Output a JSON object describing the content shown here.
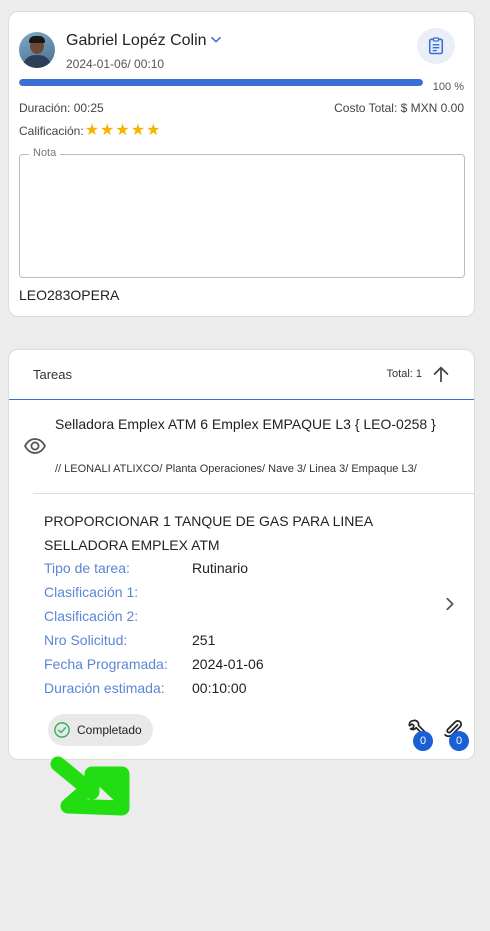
{
  "header": {
    "user_name": "Gabriel Lopéz Colin",
    "date_time": "2024-01-06/ 00:10",
    "progress_percent": 100,
    "progress_label": "100 %",
    "duration_label": "Duración:",
    "duration_value": "00:25",
    "cost_label": "Costo Total:",
    "cost_value": "$ MXN 0.00",
    "rating_label": "Calificación:",
    "rating_stars": 5,
    "note_label": "Nota",
    "note_value": "",
    "operator_code": "LEO283OPERA"
  },
  "tasks": {
    "title": "Tareas",
    "total_label": "Total: 1",
    "machine_name": "Selladora Emplex ATM 6 Emplex EMPAQUE L3 { LEO-0258 }",
    "location_path": "// LEONALI ATLIXCO/ Planta Operaciones/ Nave 3/ Linea 3/ Empaque L3/",
    "task_title": "PROPORCIONAR 1 TANQUE DE GAS PARA LINEA SELLADORA EMPLEX ATM",
    "fields": [
      {
        "label": "Tipo de tarea:",
        "value": "Rutinario"
      },
      {
        "label": "Clasificación 1:",
        "value": ""
      },
      {
        "label": "Clasificación 2:",
        "value": ""
      },
      {
        "label": "Nro Solicitud:",
        "value": "251"
      },
      {
        "label": "Fecha Programada:",
        "value": "2024-01-06"
      },
      {
        "label": "Duración estimada:",
        "value": "00:10:00"
      }
    ],
    "status": "Completado",
    "tools_count": "0",
    "attachments_count": "0"
  },
  "colors": {
    "accent": "#3b6fd6",
    "label_blue": "#5b85d6",
    "star": "#f5b400",
    "status_check": "#2fb457",
    "annotation_green": "#22dd11",
    "badge": "#1a5fd3"
  },
  "icons": [
    "chevron-down-icon",
    "clipboard-icon",
    "star-icon",
    "arrow-up-icon",
    "eye-icon",
    "chevron-right-icon",
    "check-circle-icon",
    "wrench-icon",
    "paperclip-icon",
    "green-arrow-annotation"
  ]
}
